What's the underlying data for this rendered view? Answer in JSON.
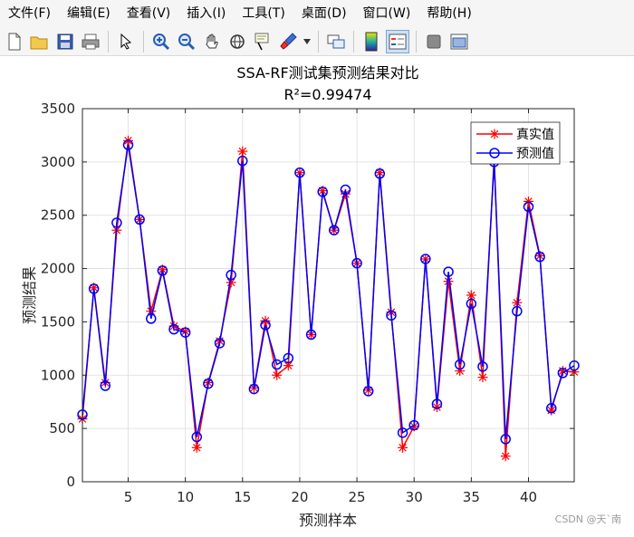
{
  "menu": [
    "文件(F)",
    "编辑(E)",
    "查看(V)",
    "插入(I)",
    "工具(T)",
    "桌面(D)",
    "窗口(W)",
    "帮助(H)"
  ],
  "toolbar_icons": [
    "new-file-icon",
    "open-folder-icon",
    "save-icon",
    "print-icon",
    "pointer-icon",
    "zoom-in-icon",
    "zoom-out-icon",
    "pan-hand-icon",
    "rotate-3d-icon",
    "data-cursor-icon",
    "brush-icon",
    "link-plot-icon",
    "colorbar-icon",
    "legend-icon",
    "hide-plot-tools-icon",
    "show-plot-tools-icon"
  ],
  "watermark": "CSDN @天`南",
  "chart_data": {
    "type": "line",
    "title": "SSA-RF测试集预测结果对比",
    "subtitle": "R²=0.99474",
    "xlabel": "预测样本",
    "ylabel": "预测结果",
    "xlim": [
      1,
      44
    ],
    "ylim": [
      0,
      3500
    ],
    "xticks": [
      5,
      10,
      15,
      20,
      25,
      30,
      35,
      40
    ],
    "yticks": [
      0,
      500,
      1000,
      1500,
      2000,
      2500,
      3000,
      3500
    ],
    "grid": true,
    "legend_position": "top-right",
    "x": [
      1,
      2,
      3,
      4,
      5,
      6,
      7,
      8,
      9,
      10,
      11,
      12,
      13,
      14,
      15,
      16,
      17,
      18,
      19,
      20,
      21,
      22,
      23,
      24,
      25,
      26,
      27,
      28,
      29,
      30,
      31,
      32,
      33,
      34,
      35,
      36,
      37,
      38,
      39,
      40,
      41,
      42,
      43,
      44
    ],
    "series": [
      {
        "name": "真实值",
        "color": "#ff0000",
        "marker": "star",
        "values": [
          590,
          1820,
          930,
          2360,
          3200,
          2460,
          1600,
          1990,
          1460,
          1410,
          320,
          930,
          1320,
          1870,
          3100,
          880,
          1510,
          1000,
          1090,
          2900,
          1380,
          2730,
          2360,
          2700,
          2050,
          860,
          2900,
          1590,
          320,
          520,
          2090,
          700,
          1880,
          1040,
          1750,
          980,
          3040,
          240,
          1680,
          2630,
          2120,
          670,
          1040,
          1030
        ]
      },
      {
        "name": "预测值",
        "color": "#0000ff",
        "marker": "circle",
        "values": [
          630,
          1810,
          900,
          2430,
          3160,
          2460,
          1530,
          1980,
          1430,
          1400,
          420,
          920,
          1300,
          1940,
          3010,
          870,
          1470,
          1100,
          1160,
          2900,
          1380,
          2720,
          2360,
          2740,
          2050,
          850,
          2890,
          1560,
          460,
          530,
          2090,
          730,
          1970,
          1100,
          1670,
          1080,
          3000,
          400,
          1600,
          2580,
          2110,
          690,
          1020,
          1090
        ]
      }
    ]
  }
}
